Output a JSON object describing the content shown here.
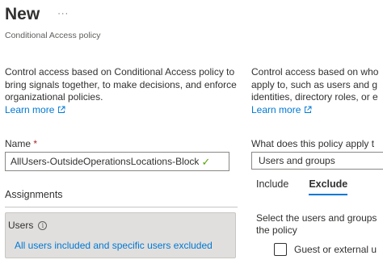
{
  "header": {
    "title": "New",
    "more_label": "···",
    "subtitle": "Conditional Access policy"
  },
  "left": {
    "description": "Control access based on Conditional Access policy to bring signals together, to make decisions, and enforce organizational policies.",
    "learn_more": "Learn more",
    "name_label": "Name",
    "required_marker": "*",
    "name_value": "AllUsers-OutsideOperationsLocations-Block",
    "name_check": "✓",
    "assignments_label": "Assignments",
    "users": {
      "label": "Users",
      "info_glyph": "i",
      "summary": "All users included and specific users excluded"
    }
  },
  "right": {
    "description_lines": [
      "Control access based on who",
      "apply to, such as users and g",
      "identities, directory roles, or e"
    ],
    "learn_more": "Learn more",
    "question": "What does this policy apply t",
    "select_value": "Users and groups",
    "tabs": [
      {
        "label": "Include",
        "active": false
      },
      {
        "label": "Exclude",
        "active": true
      }
    ],
    "select_desc_lines": [
      "Select the users and groups",
      "the policy"
    ],
    "checkbox_label": "Guest or external u"
  },
  "colors": {
    "link": "#0078d4",
    "check": "#57a300",
    "required": "#a4262c",
    "card_bg": "#e1dfdd"
  }
}
